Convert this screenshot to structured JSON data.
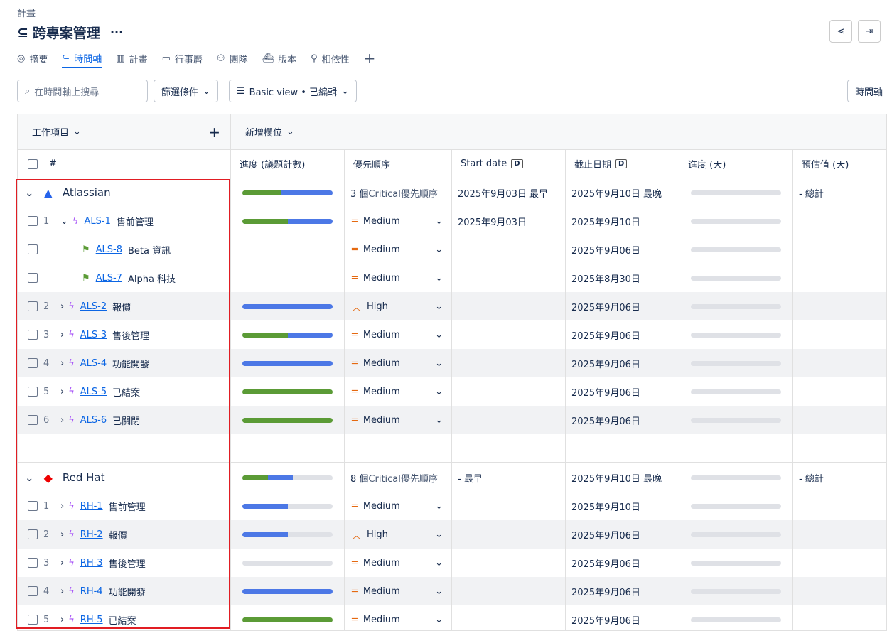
{
  "crumb": "計畫",
  "title": "跨專案管理",
  "more": "···",
  "tabs": [
    "摘要",
    "時間軸",
    "計畫",
    "行事曆",
    "團隊",
    "版本",
    "相依性"
  ],
  "search_placeholder": "在時間軸上搜尋",
  "filter": "篩選條件",
  "view": "Basic view • 已編輯",
  "right_btn": "時間軸",
  "header": {
    "work": "工作項目",
    "add_col": "新增欄位",
    "num": "#",
    "cols": [
      "進度 (議題計數)",
      "優先順序",
      "Start date",
      "截止日期",
      "進度 (天)",
      "預估值 (天)"
    ],
    "d": "D"
  },
  "groups": [
    {
      "name": "Atlassian",
      "summary": {
        "progress": [
          0.43,
          0.57
        ],
        "count": "3 個",
        "pri": "Critical優先順序",
        "start": "2025年9月03日 最早",
        "due": "2025年9月10日 最晚",
        "est": "- 總計"
      },
      "rows": [
        {
          "n": "1",
          "expand": "down",
          "key": "ALS-1",
          "name": "售前管理",
          "progress": [
            0.5,
            0.5
          ],
          "pri": "Medium",
          "start": "2025年9月03日",
          "due": "2025年9月10日"
        },
        {
          "n": "",
          "expand": "",
          "key": "ALS-8",
          "name": "Beta 資訊",
          "sub": true,
          "progress": null,
          "pri": "Medium",
          "start": "",
          "due": "2025年9月06日"
        },
        {
          "n": "",
          "expand": "",
          "key": "ALS-7",
          "name": "Alpha 科技",
          "sub": true,
          "progress": null,
          "pri": "Medium",
          "start": "",
          "due": "2025年8月30日"
        },
        {
          "n": "2",
          "expand": "right",
          "key": "ALS-2",
          "name": "報價",
          "progress": [
            0,
            1
          ],
          "pri": "High",
          "start": "",
          "due": "2025年9月06日"
        },
        {
          "n": "3",
          "expand": "right",
          "key": "ALS-3",
          "name": "售後管理",
          "progress": [
            0.5,
            0.5
          ],
          "pri": "Medium",
          "start": "",
          "due": "2025年9月06日"
        },
        {
          "n": "4",
          "expand": "right",
          "key": "ALS-4",
          "name": "功能開發",
          "progress": [
            0,
            1
          ],
          "pri": "Medium",
          "start": "",
          "due": "2025年9月06日"
        },
        {
          "n": "5",
          "expand": "right",
          "key": "ALS-5",
          "name": "已結案",
          "progress": [
            1,
            0
          ],
          "pri": "Medium",
          "start": "",
          "due": "2025年9月06日"
        },
        {
          "n": "6",
          "expand": "right",
          "key": "ALS-6",
          "name": "已關閉",
          "progress": [
            1,
            0
          ],
          "pri": "Medium",
          "start": "",
          "due": "2025年9月06日"
        }
      ]
    },
    {
      "name": "Red Hat",
      "summary": {
        "progress": [
          0.28,
          0.28
        ],
        "count": "8 個",
        "pri": "Critical優先順序",
        "start": "- 最早",
        "due": "2025年9月10日 最晚",
        "est": "- 總計"
      },
      "rows": [
        {
          "n": "1",
          "expand": "right",
          "key": "RH-1",
          "name": "售前管理",
          "progress": [
            0,
            0.5
          ],
          "pri": "Medium",
          "start": "",
          "due": "2025年9月10日"
        },
        {
          "n": "2",
          "expand": "right",
          "key": "RH-2",
          "name": "報價",
          "progress": [
            0,
            0.5
          ],
          "pri": "High",
          "start": "",
          "due": "2025年9月06日"
        },
        {
          "n": "3",
          "expand": "right",
          "key": "RH-3",
          "name": "售後管理",
          "progress": [
            0,
            0
          ],
          "pri": "Medium",
          "start": "",
          "due": "2025年9月06日"
        },
        {
          "n": "4",
          "expand": "right",
          "key": "RH-4",
          "name": "功能開發",
          "progress": [
            0,
            1
          ],
          "pri": "Medium",
          "start": "",
          "due": "2025年9月06日"
        },
        {
          "n": "5",
          "expand": "right",
          "key": "RH-5",
          "name": "已結案",
          "progress": [
            1,
            0
          ],
          "pri": "Medium",
          "start": "",
          "due": "2025年9月06日"
        }
      ]
    }
  ]
}
